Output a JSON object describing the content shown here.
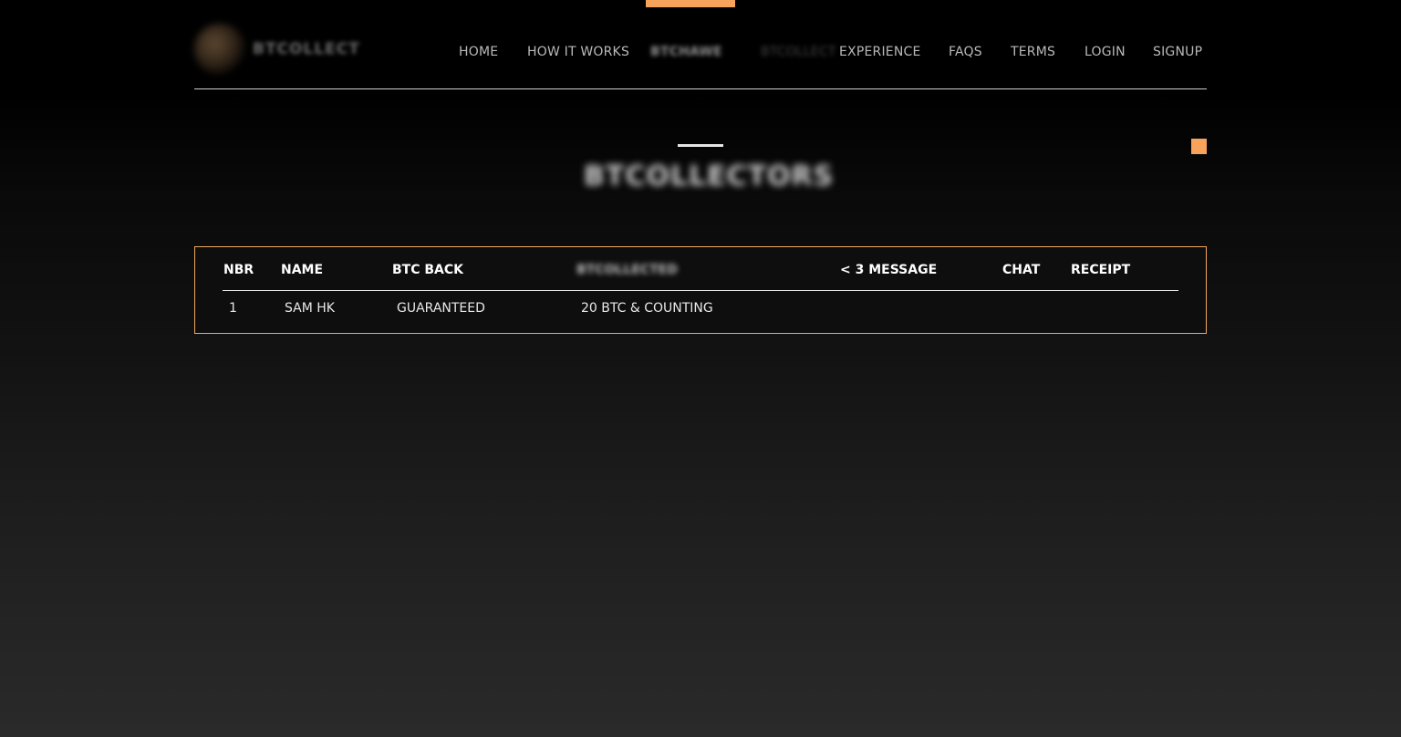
{
  "brand": {
    "name": "BTCOLLECT"
  },
  "nav": {
    "home": "HOME",
    "how_it_works": "HOW IT WORKS",
    "blurred_item_1": "BTCHAWE",
    "blurred_item_2": "BTCOLLECT",
    "experience": "EXPERIENCE",
    "faqs": "FAQS",
    "terms": "TERMS",
    "login": "LOGIN",
    "signup": "SIGNUP"
  },
  "page": {
    "title_blurred": "BTCOLLECTORS"
  },
  "table": {
    "headers": {
      "nbr": "NBR",
      "name": "NAME",
      "btc_back": "BTC BACK",
      "blurred": "BTCOLLECTED",
      "message": "< 3 MESSAGE",
      "chat": "CHAT",
      "receipt": "RECEIPT"
    },
    "rows": [
      {
        "nbr": "1",
        "name": "SAM HK",
        "btc_back": "GUARANTEED",
        "collected": "20 BTC & COUNTING",
        "message": "",
        "chat": "",
        "receipt": ""
      }
    ]
  },
  "colors": {
    "accent": "#f7a35c",
    "background": "#000000",
    "table_border": "#f0a760"
  }
}
